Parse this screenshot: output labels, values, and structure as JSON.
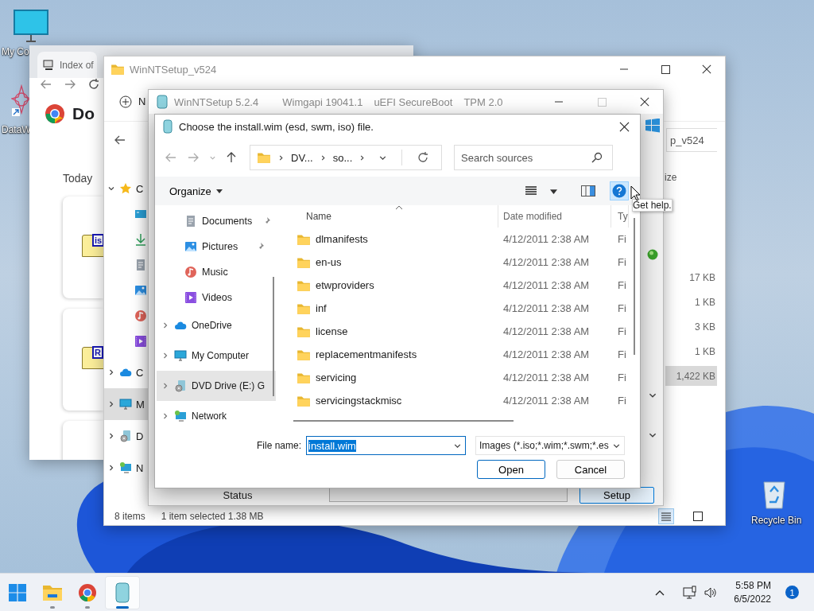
{
  "desktop_icons": [
    {
      "label": "My Co",
      "kind": "computer"
    },
    {
      "label": "DataW",
      "kind": "shortcut"
    },
    {
      "label": "Recycle Bin",
      "kind": "recycle"
    }
  ],
  "browser_window": {
    "tab_title": "Index of",
    "heading": "Do",
    "section": "Today",
    "cards": [
      {
        "kind": "file",
        "badge": "is"
      },
      {
        "kind": "file",
        "badge": "R"
      },
      {
        "kind": "blank"
      }
    ]
  },
  "explorer_window": {
    "title": "WinNTSetup_v524",
    "new_button": "N",
    "search": {
      "placeholder": "p_v524"
    },
    "nav_items": [
      {
        "label": "C",
        "kind": "star",
        "expanded": true,
        "selected": false
      },
      {
        "label": "C",
        "kind": "cloud",
        "expanded": false,
        "selected": false
      },
      {
        "label": "M",
        "kind": "computer",
        "expanded": false,
        "selected": true
      },
      {
        "label": "D",
        "kind": "drive",
        "expanded": false,
        "selected": false
      },
      {
        "label": "N",
        "kind": "network",
        "expanded": false,
        "selected": false
      }
    ],
    "size_header": "ize",
    "sizes": [
      {
        "text": "17 KB",
        "selected": false
      },
      {
        "text": "1 KB",
        "selected": false
      },
      {
        "text": "3 KB",
        "selected": false
      },
      {
        "text": "1 KB",
        "selected": false
      },
      {
        "text": "1,422 KB",
        "selected": true
      }
    ],
    "status_items": "8 items",
    "status_selection": "1 item selected  1.38 MB",
    "view_buttons": [
      {
        "kind": "details",
        "selected": true
      },
      {
        "kind": "tiles",
        "selected": false
      }
    ]
  },
  "setup_window": {
    "title": "WinNTSetup 5.2.4",
    "info": [
      "Wimgapi 19041.1",
      "uEFI SecureBoot",
      "TPM 2.0"
    ],
    "status_label": "Status",
    "progress": {
      "level": 0
    },
    "setup_button": "Setup"
  },
  "dialog": {
    "title": "Choose the install.wim (esd, swm, iso) file.",
    "path": [
      "DV...",
      "so..."
    ],
    "search": {
      "placeholder": "Search sources"
    },
    "organize": "Organize",
    "help_button": {
      "highlighted": true
    },
    "tooltip": "Get help.",
    "nav": [
      {
        "label": "Documents",
        "kind": "documents",
        "expandable": false,
        "pinned": true,
        "selected": false
      },
      {
        "label": "Pictures",
        "kind": "pictures",
        "expandable": false,
        "pinned": true,
        "selected": false
      },
      {
        "label": "Music",
        "kind": "music",
        "expandable": false,
        "pinned": false,
        "selected": false
      },
      {
        "label": "Videos",
        "kind": "videos",
        "expandable": false,
        "pinned": false,
        "selected": false
      },
      {
        "label": "OneDrive",
        "kind": "cloud",
        "expandable": true,
        "pinned": false,
        "selected": false
      },
      {
        "label": "My Computer",
        "kind": "computer",
        "expandable": true,
        "pinned": false,
        "selected": false
      },
      {
        "label": "DVD Drive (E:) G",
        "kind": "drive",
        "expandable": true,
        "pinned": false,
        "selected": true
      },
      {
        "label": "Network",
        "kind": "network",
        "expandable": true,
        "pinned": false,
        "selected": false
      }
    ],
    "columns": [
      "Name",
      "Date modified",
      "Ty"
    ],
    "rows": [
      {
        "name": "dlmanifests",
        "date": "4/12/2011 2:38 AM",
        "type": "Fi"
      },
      {
        "name": "en-us",
        "date": "4/12/2011 2:38 AM",
        "type": "Fi"
      },
      {
        "name": "etwproviders",
        "date": "4/12/2011 2:38 AM",
        "type": "Fi"
      },
      {
        "name": "inf",
        "date": "4/12/2011 2:38 AM",
        "type": "Fi"
      },
      {
        "name": "license",
        "date": "4/12/2011 2:38 AM",
        "type": "Fi"
      },
      {
        "name": "replacementmanifests",
        "date": "4/12/2011 2:38 AM",
        "type": "Fi"
      },
      {
        "name": "servicing",
        "date": "4/12/2011 2:38 AM",
        "type": "Fi"
      },
      {
        "name": "servicingstackmisc",
        "date": "4/12/2011 2:38 AM",
        "type": "Fi"
      }
    ],
    "file_name_label": "File name:",
    "file_name": {
      "value": "install.wim",
      "text_selected": true
    },
    "filter": "Images (*.iso;*.wim;*.swm;*.es",
    "buttons": [
      {
        "label": "Open",
        "default": true
      },
      {
        "label": "Cancel",
        "default": false
      }
    ]
  },
  "taskbar": {
    "apps": [
      {
        "kind": "start",
        "running": false,
        "active": false
      },
      {
        "kind": "explorer",
        "running": true,
        "active": false
      },
      {
        "kind": "chrome",
        "running": true,
        "active": false
      },
      {
        "kind": "setup",
        "running": true,
        "active": true
      }
    ],
    "time": "5:58 PM",
    "date": "6/5/2022",
    "notification_count": "1"
  }
}
